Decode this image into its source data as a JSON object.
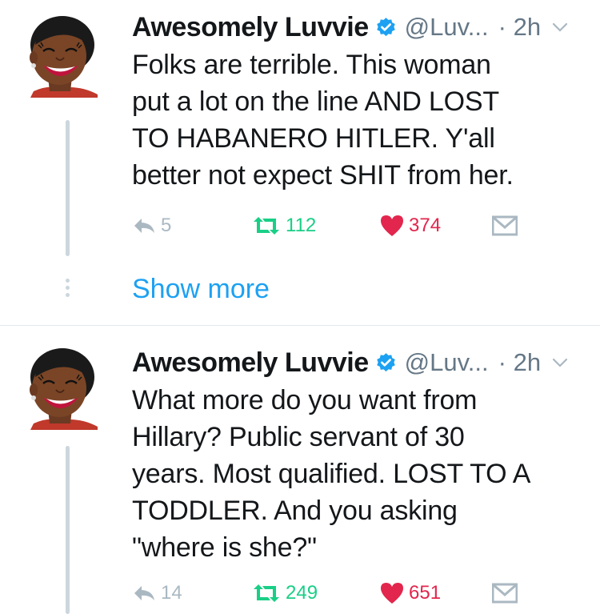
{
  "tweets": [
    {
      "author": {
        "name": "Awesomely Luvvie",
        "handle": "@Luv...",
        "verified": true,
        "avatar": "cartoon-avatar-icon"
      },
      "time": "· 2h",
      "lines": [
        "Folks are terrible. This woman",
        "put a lot on the line AND LOST",
        "TO HABANERO HITLER. Y'all",
        "better not expect SHIT from her."
      ],
      "actions": {
        "replies": "5",
        "retweets": "112",
        "likes": "374"
      }
    },
    {
      "author": {
        "name": "Awesomely Luvvie",
        "handle": "@Luv...",
        "verified": true,
        "avatar": "cartoon-avatar-icon"
      },
      "time": "· 2h",
      "lines": [
        "What more do you want from",
        "Hillary? Public servant of 30",
        "years. Most qualified. LOST TO A",
        "TODDLER. And you asking",
        "\"where is she?\""
      ],
      "actions": {
        "replies": "14",
        "retweets": "249",
        "likes": "651"
      }
    }
  ],
  "show_more_label": "Show more",
  "colors": {
    "link": "#1da1f2",
    "retweet": "#19cf86",
    "like": "#e2264d",
    "muted": "#657786",
    "icon": "#aab8c2",
    "verified": "#1da1f2"
  }
}
